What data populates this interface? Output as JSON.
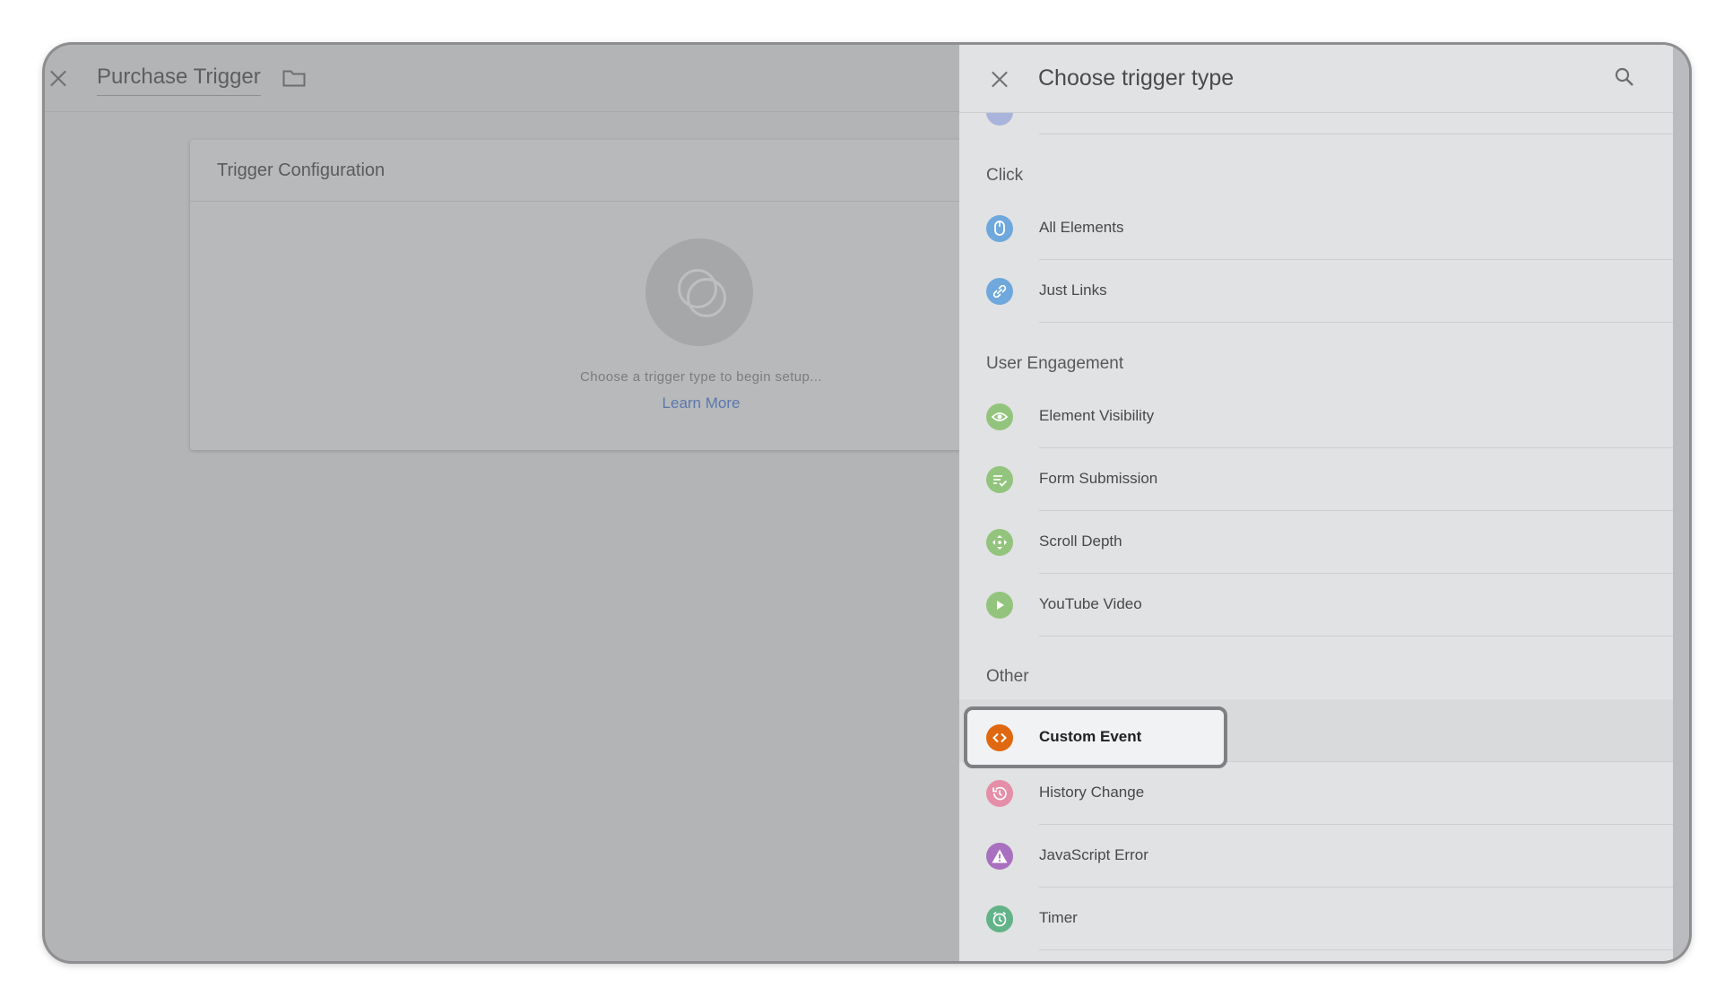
{
  "editor": {
    "title": "Purchase Trigger",
    "card_title": "Trigger Configuration",
    "hint": "Choose a trigger type to begin setup...",
    "learn_more": "Learn More"
  },
  "panel": {
    "title": "Choose trigger type",
    "sections": {
      "click": "Click",
      "engagement": "User Engagement",
      "other": "Other"
    },
    "items": {
      "all_elements": "All Elements",
      "just_links": "Just Links",
      "element_visibility": "Element Visibility",
      "form_submission": "Form Submission",
      "scroll_depth": "Scroll Depth",
      "youtube_video": "YouTube Video",
      "custom_event": "Custom Event",
      "history_change": "History Change",
      "javascript_error": "JavaScript Error",
      "timer": "Timer"
    }
  },
  "colors": {
    "click_icon": "#6fa8dc",
    "engagement_icon": "#93c47d",
    "custom_event_icon": "#e06810",
    "history_icon": "#e58ea8",
    "js_error_icon": "#a970c0",
    "timer_icon": "#62b387"
  }
}
